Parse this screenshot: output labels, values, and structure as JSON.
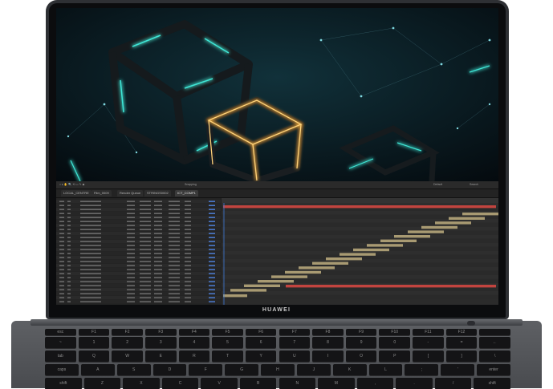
{
  "brand": "HUAWEI",
  "toolbar": {
    "mode_label": "Snapping",
    "workspace": "Default",
    "search": "Search"
  },
  "tabs": [
    "LOCAL_CENTRE",
    "Film_0009",
    "Render Queue",
    "STRINGS0002",
    "ICT_COMP1"
  ],
  "keyboard": {
    "row0": [
      "esc",
      "F1",
      "F2",
      "F3",
      "F4",
      "F5",
      "F6",
      "F7",
      "F8",
      "F9",
      "F10",
      "F11",
      "F12",
      ""
    ],
    "row1": [
      "~",
      "1",
      "2",
      "3",
      "4",
      "5",
      "6",
      "7",
      "8",
      "9",
      "0",
      "-",
      "=",
      "←"
    ],
    "row2": [
      "tab",
      "Q",
      "W",
      "E",
      "R",
      "T",
      "Y",
      "U",
      "I",
      "O",
      "P",
      "[",
      "]",
      "\\"
    ],
    "row3": [
      "caps",
      "A",
      "S",
      "D",
      "F",
      "G",
      "H",
      "J",
      "K",
      "L",
      ";",
      "'",
      "enter"
    ],
    "row4": [
      "shift",
      "Z",
      "X",
      "C",
      "V",
      "B",
      "N",
      "M",
      ",",
      ".",
      "/",
      "shift"
    ]
  },
  "colors": {
    "accent_cyan": "#3fe6d6",
    "accent_orange": "#ffb23a",
    "bar_tan": "#a89a72",
    "bar_red": "#c2443f"
  }
}
